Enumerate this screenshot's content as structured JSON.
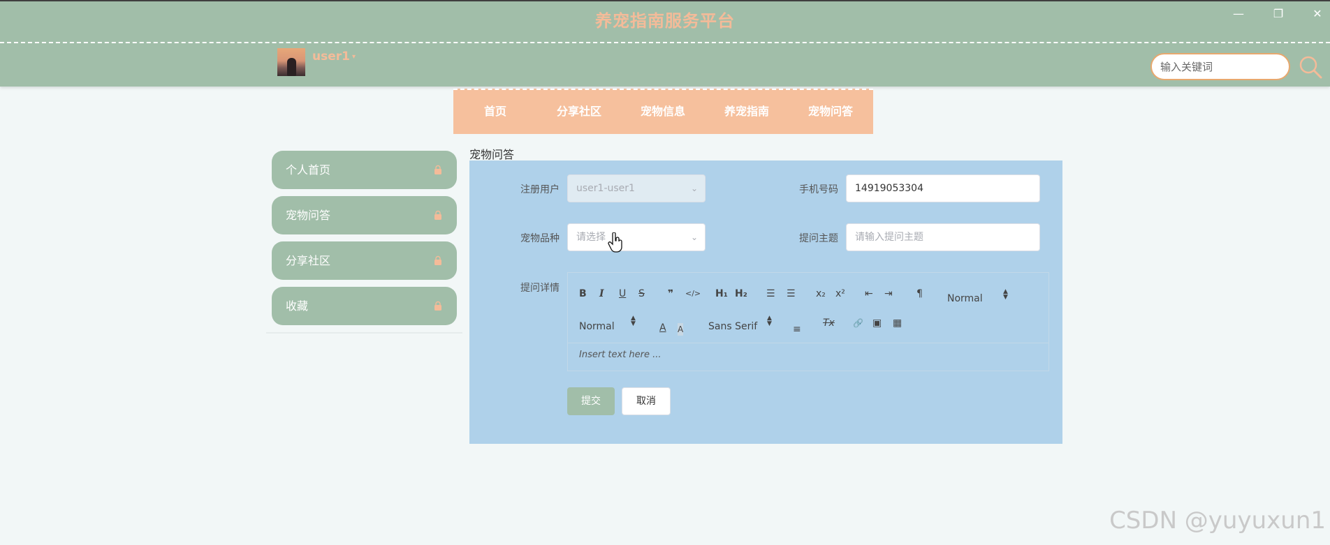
{
  "header": {
    "site_title": "养宠指南服务平台",
    "window_controls": {
      "minimize": "—",
      "restore": "❐",
      "close": "✕"
    },
    "user": {
      "name": "user1",
      "caret": "▾"
    },
    "search": {
      "placeholder": "输入关键词"
    }
  },
  "nav": {
    "items": [
      "首页",
      "分享社区",
      "宠物信息",
      "养宠指南",
      "宠物问答"
    ]
  },
  "sidebar": {
    "items": [
      {
        "label": "个人首页",
        "icon": "lock-icon"
      },
      {
        "label": "宠物问答",
        "icon": "lock-icon"
      },
      {
        "label": "分享社区",
        "icon": "lock-icon"
      },
      {
        "label": "收藏",
        "icon": "lock-icon"
      }
    ]
  },
  "main": {
    "section_title": "宠物问答",
    "form": {
      "registered_user": {
        "label": "注册用户",
        "value": "user1-user1",
        "chevron": "⌄"
      },
      "phone": {
        "label": "手机号码",
        "value": "14919053304"
      },
      "pet_breed": {
        "label": "宠物品种",
        "placeholder": "请选择",
        "chevron": "⌄"
      },
      "question_topic": {
        "label": "提问主题",
        "placeholder": "请输入提问主题"
      },
      "question_detail": {
        "label": "提问详情"
      },
      "editor": {
        "bold": "B",
        "italic": "I",
        "underline": "U",
        "strike": "S",
        "blockquote": "❞",
        "code": "</>",
        "h1": "H₁",
        "h2": "H₂",
        "ordered_list": "☰",
        "bullet_list": "☰",
        "subscript": "x₂",
        "superscript": "x²",
        "outdent": "⇤",
        "indent": "⇥",
        "direction": "¶",
        "size_select": "Normal",
        "header_select": "Normal",
        "font_select": "Sans Serif",
        "color": "A",
        "background": "A",
        "align": "≡",
        "clean": "Tx",
        "link": "🔗",
        "image": "▣",
        "video": "▦",
        "placeholder": "Insert text here ..."
      },
      "submit_label": "提交",
      "cancel_label": "取消"
    }
  },
  "watermark": "CSDN @yuyuxun1",
  "colors": {
    "header_bg": "#a1bea9",
    "title_accent": "#f4bb99",
    "nav_bg": "#f6c09d",
    "panel_bg": "#afd1ea",
    "sidebar_bg": "#a1bea9",
    "search_border": "#e8a86e"
  }
}
